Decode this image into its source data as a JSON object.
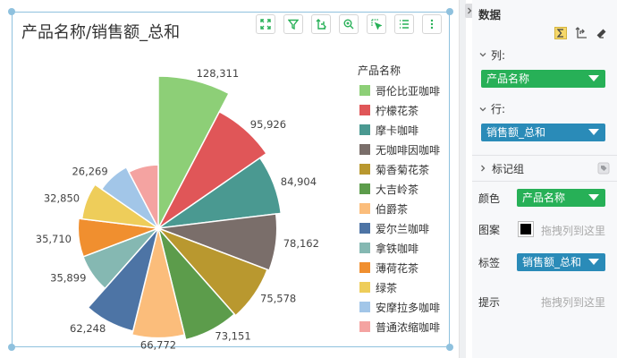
{
  "chart": {
    "title": "产品名称/销售额_总和",
    "legend_title": "产品名称",
    "toolbar_icons": [
      "fullscreen-icon",
      "filter-icon",
      "swap-axes-icon",
      "zoom-in-icon",
      "select-icon",
      "list-icon",
      "more-icon"
    ]
  },
  "chart_data": {
    "type": "pie",
    "subtype": "rose",
    "title": "产品名称/销售额_总和",
    "legend_title": "产品名称",
    "legend_position": "right",
    "categories": [
      "哥伦比亚咖啡",
      "柠檬花茶",
      "摩卡咖啡",
      "无咖啡因咖啡",
      "菊香菊花茶",
      "大吉岭茶",
      "伯爵茶",
      "爱尔兰咖啡",
      "拿铁咖啡",
      "薄荷花茶",
      "绿茶",
      "安摩拉多咖啡",
      "普通浓缩咖啡"
    ],
    "values": [
      128311,
      95926,
      84904,
      78162,
      75578,
      73151,
      66772,
      62248,
      35899,
      35710,
      32850,
      26269,
      null
    ],
    "value_labels": [
      "128,311",
      "95,926",
      "84,904",
      "78,162",
      "75,578",
      "73,151",
      "66,772",
      "62,248",
      "35,899",
      "35,710",
      "32,850",
      "26,269",
      ""
    ],
    "colors": [
      "#8dcf77",
      "#e05658",
      "#4a9991",
      "#7a6e6a",
      "#b9982f",
      "#5c9c4b",
      "#fbbd7b",
      "#4d74a5",
      "#85b8b2",
      "#f08f2f",
      "#eecd5a",
      "#a2c6e8",
      "#f4a3a1"
    ]
  },
  "panel": {
    "title": "数据",
    "icons": [
      "sum-icon",
      "swap-axes-icon",
      "eraser-icon"
    ],
    "columns": {
      "label": "列:",
      "field": "产品名称"
    },
    "rows": {
      "label": "行:",
      "field": "销售额_总和"
    },
    "marks": {
      "label": "标记组"
    },
    "color": {
      "label": "颜色",
      "field": "产品名称"
    },
    "pattern": {
      "label": "图案",
      "placeholder": "拖拽列到这里"
    },
    "tag": {
      "label": "标签",
      "field": "销售额_总和"
    },
    "tooltip": {
      "label": "提示",
      "placeholder": "拖拽列到这里"
    }
  }
}
